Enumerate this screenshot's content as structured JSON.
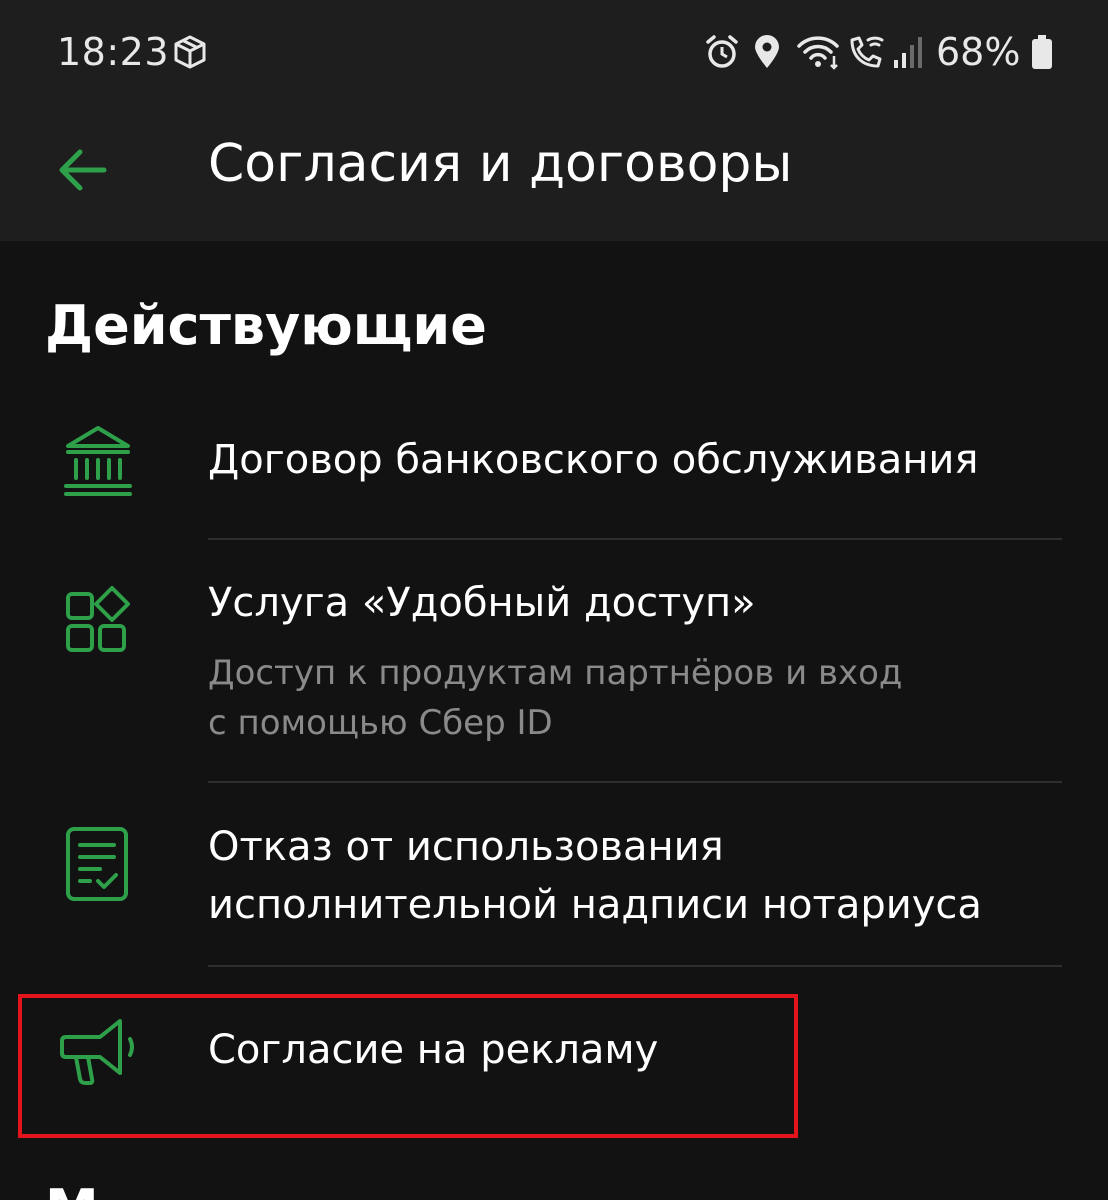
{
  "status_bar": {
    "time": "18:23",
    "battery_percent": "68%",
    "icons": [
      "package-icon",
      "alarm-icon",
      "location-icon",
      "wifi-calling-icon",
      "call-wifi-icon",
      "signal-icon",
      "battery-icon"
    ]
  },
  "app_bar": {
    "title": "Согласия и договоры",
    "back_icon": "arrow-left-icon"
  },
  "colors": {
    "accent": "#2fa04a",
    "background": "#121212",
    "panel": "#1e1e1e",
    "highlight": "#e3141c"
  },
  "section": {
    "heading": "Действующие",
    "items": [
      {
        "icon": "bank-icon",
        "title_lines": [
          "Договор банковского обслуживания"
        ],
        "subtitle_lines": []
      },
      {
        "icon": "apps-grid-icon",
        "title_lines": [
          "Услуга «Удобный доступ»"
        ],
        "subtitle_lines": [
          "Доступ к продуктам партнёров и вход",
          "с помощью Сбер ID"
        ]
      },
      {
        "icon": "document-check-icon",
        "title_lines": [
          "Отказ от использования",
          "исполнительной надписи нотариуса"
        ],
        "subtitle_lines": []
      },
      {
        "icon": "megaphone-icon",
        "title_lines": [
          "Согласие на рекламу"
        ],
        "subtitle_lines": []
      }
    ]
  },
  "next_section": {
    "heading_partial": "М"
  }
}
